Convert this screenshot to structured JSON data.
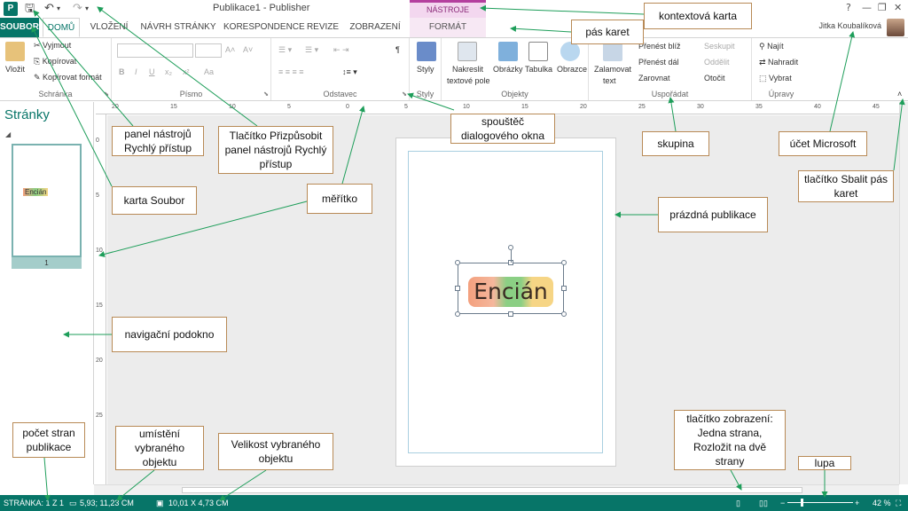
{
  "titlebar": {
    "app_icon": "P",
    "title": "Publikace1 - Publisher",
    "context_title": "NÁSTROJE OBRÁZKU",
    "user": "Jitka Koubalíková"
  },
  "tabs": [
    "SOUBOR",
    "DOMŮ",
    "VLOŽENÍ",
    "NÁVRH STRÁNKY",
    "KORESPONDENCE",
    "REVIZE",
    "ZOBRAZENÍ",
    "FORMÁT"
  ],
  "ribbon": {
    "clipboard": {
      "paste": "Vložit",
      "cut": "Vyjmout",
      "copy": "Kopírovat",
      "format_painter": "Kopírovat formát",
      "label": "Schránka"
    },
    "font": {
      "label": "Písmo",
      "buttons": [
        "B",
        "I",
        "U",
        "x₂",
        "x²",
        "Aa"
      ]
    },
    "paragraph": {
      "label": "Odstavec"
    },
    "styles": {
      "button": "Styly",
      "label": "Styly"
    },
    "objects": {
      "draw_textbox_1": "Nakreslit",
      "draw_textbox_2": "textové pole",
      "pictures": "Obrázky",
      "table": "Tabulka",
      "shapes": "Obrazce",
      "label": "Objekty"
    },
    "arrange": {
      "wrap_1": "Zalamovat",
      "wrap_2": "text",
      "bring_forward": "Přenést blíž",
      "send_backward": "Přenést dál",
      "align": "Zarovnat",
      "group": "Seskupit",
      "ungroup": "Oddělit",
      "rotate": "Otočit",
      "label": "Uspořádat"
    },
    "editing": {
      "find": "Najít",
      "replace": "Nahradit",
      "select": "Vybrat",
      "label": "Úpravy"
    }
  },
  "ruler": {
    "h_ticks": [
      "20",
      "15",
      "10",
      "5",
      "0",
      "5",
      "10",
      "15",
      "20",
      "25",
      "30",
      "35",
      "40",
      "45"
    ],
    "v_ticks": [
      "0",
      "5",
      "10",
      "15",
      "20",
      "25"
    ]
  },
  "navpane": {
    "title": "Stránky",
    "thumb_text": "Encián",
    "page_number": "1"
  },
  "publication": {
    "wordart": "Encián"
  },
  "statusbar": {
    "page": "STRÁNKA: 1 Z 1",
    "position": "5,93; 11,23 CM",
    "size": "10,01 X 4,73 CM",
    "zoom": "42 %"
  },
  "callouts": {
    "context_tab": "kontextová karta",
    "ribbon": "pás karet",
    "qat": "panel nástrojů Rychlý přístup",
    "qat_customize": "Tlačítko Přizpůsobit panel nástrojů Rychlý přístup",
    "dialog_launcher": "spouštěč dialogového okna",
    "group": "skupina",
    "ms_account": "účet Microsoft",
    "collapse_ribbon": "tlačítko Sbalit pás karet",
    "file_tab": "karta Soubor",
    "ruler": "měřítko",
    "blank_publication": "prázdná publikace",
    "nav_pane": "navigační podokno",
    "page_count": "počet stran publikace",
    "object_position": "umístění vybraného objektu",
    "object_size": "Velikost vybraného objektu",
    "view_buttons": "tlačítko zobrazení: Jedna strana, Rozložit na dvě strany",
    "zoom": "lupa"
  },
  "colors": {
    "accent": "#077568",
    "context": "#b43f9e",
    "arrow": "#1e9e5a",
    "callout_border": "#b88a56"
  }
}
